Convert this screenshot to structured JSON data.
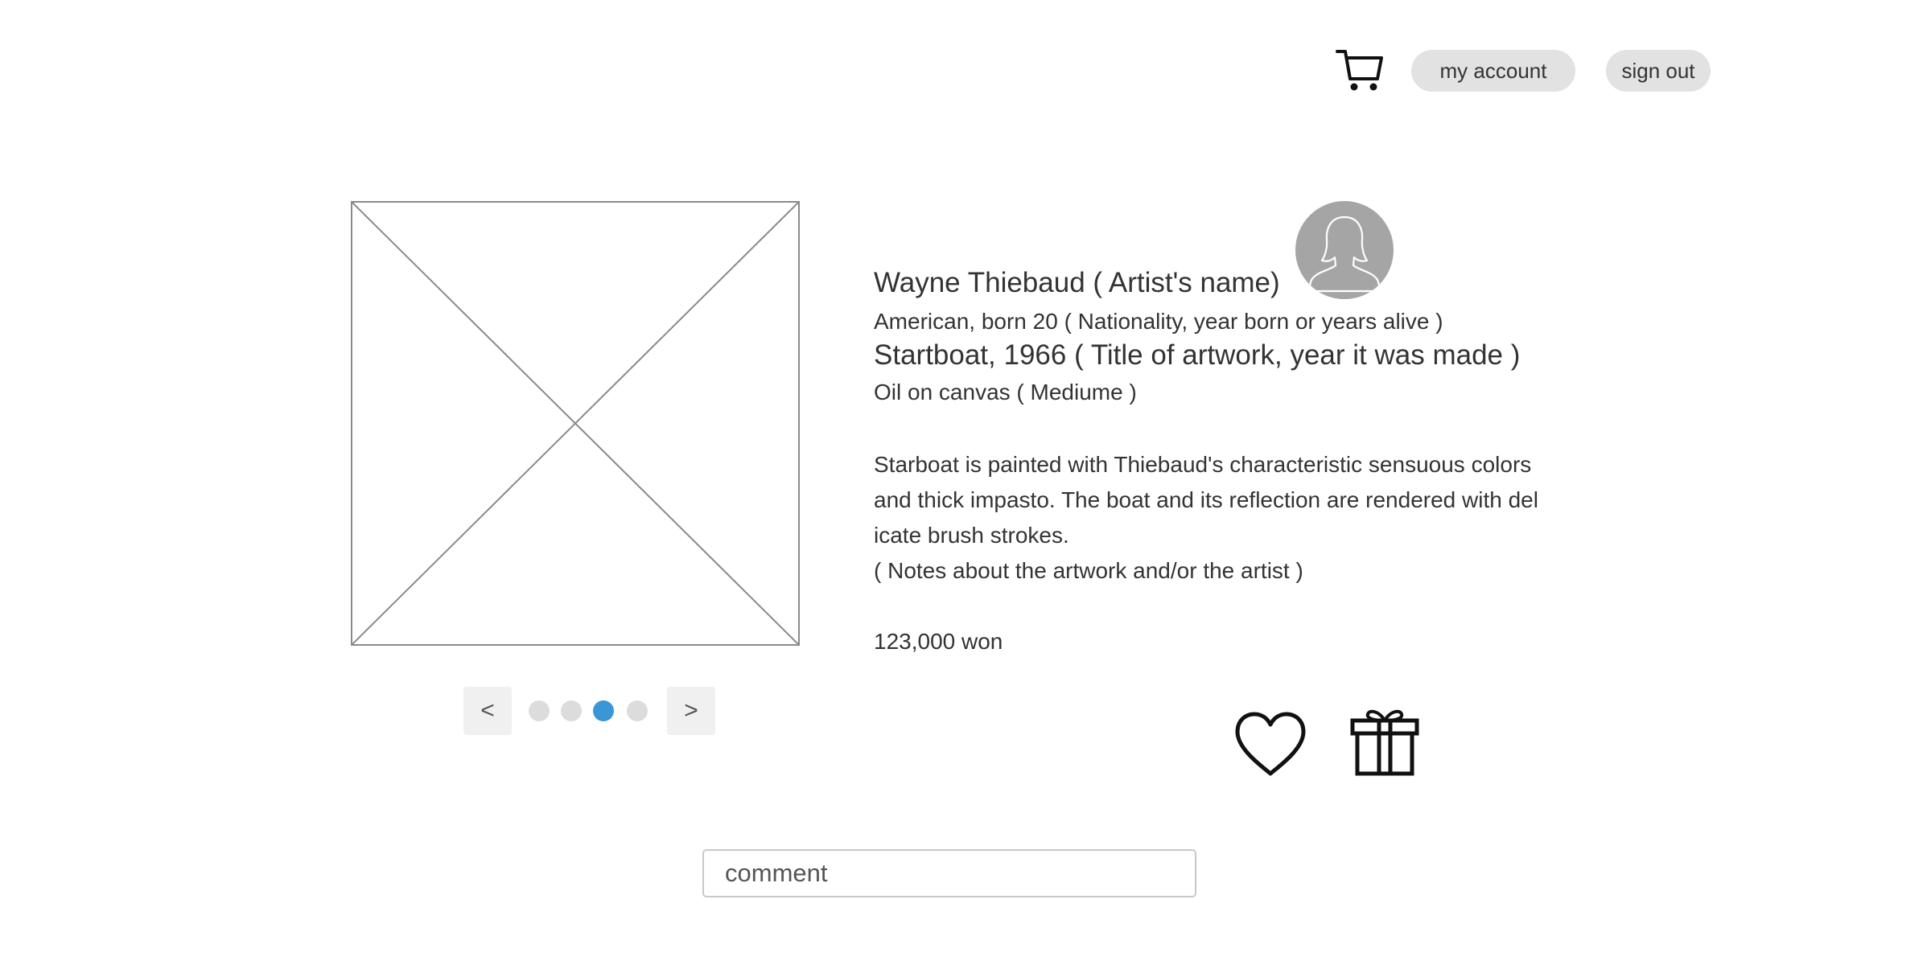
{
  "header": {
    "cart_icon": "shopping-cart-icon",
    "account_label": "my account",
    "signout_label": "sign out"
  },
  "gallery": {
    "image_icon": "image-placeholder",
    "prev_label": "<",
    "next_label": ">",
    "dot_count": 4,
    "active_dot": 3,
    "active_color": "#3a96d6",
    "inactive_color": "#dcdcdc"
  },
  "artist": {
    "avatar_icon": "user-avatar-icon",
    "name": "Wayne Thiebaud ( Artist's name)",
    "nationality": "American, born 20 ( Nationality, year born or years alive )"
  },
  "artwork": {
    "title": "Startboat, 1966 ( Title of artwork, year it was made )",
    "medium": "Oil on canvas ( Mediume )",
    "description": "Starboat is painted with Thiebaud's characteristic sensuous colors and thick impasto. The boat and its reflection are rendered with delicate brush strokes.",
    "notes": "( Notes about the artwork and/or the artist )",
    "price": "123,000 won"
  },
  "actions": {
    "like_icon": "heart-icon",
    "gift_icon": "gift-icon"
  },
  "comment": {
    "placeholder": "comment",
    "value": ""
  }
}
